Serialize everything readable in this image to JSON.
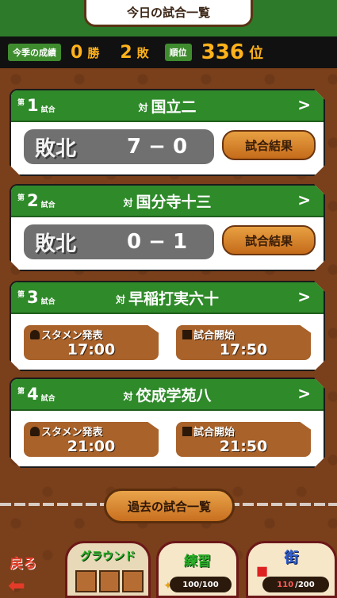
{
  "header": {
    "title": "今日の試合一覧"
  },
  "record": {
    "season_label": "今季の成績",
    "wins": "0",
    "wins_unit": "勝",
    "losses": "2",
    "losses_unit": "敗",
    "rank_label": "順位",
    "rank": "336",
    "rank_unit": "位"
  },
  "games": [
    {
      "dai": "第",
      "number": "1",
      "shiai": "試合",
      "vs": "対",
      "opponent": "国立二",
      "result": "敗北",
      "score": "7 − 0",
      "button": "試合結果"
    },
    {
      "dai": "第",
      "number": "2",
      "shiai": "試合",
      "vs": "対",
      "opponent": "国分寺十三",
      "result": "敗北",
      "score": "0 − 1",
      "button": "試合結果"
    },
    {
      "dai": "第",
      "number": "3",
      "shiai": "試合",
      "vs": "対",
      "opponent": "早稲打実六十",
      "lineup_label": "スタメン発表",
      "lineup_time": "17:00",
      "start_label": "試合開始",
      "start_time": "17:50"
    },
    {
      "dai": "第",
      "number": "4",
      "shiai": "試合",
      "vs": "対",
      "opponent": "佼成学苑八",
      "lineup_label": "スタメン発表",
      "lineup_time": "21:00",
      "start_label": "試合開始",
      "start_time": "21:50"
    }
  ],
  "past_button": "過去の試合一覧",
  "nav": {
    "back": "戻る",
    "ground": "グラウンド",
    "practice": "練習",
    "practice_counter": "100/100",
    "town": "街",
    "town_counter_current": "110",
    "town_counter_max": "/200"
  },
  "colors": {
    "accent_green": "#2f8a2a",
    "score_orange": "#ffb21b",
    "button_orange": "#e08c30",
    "background_brown": "#7a3f1b"
  },
  "icons": [
    "chevron-right-icon",
    "person-icon",
    "stadium-icon",
    "back-arrow-icon",
    "fire-icon",
    "shop-icon"
  ]
}
